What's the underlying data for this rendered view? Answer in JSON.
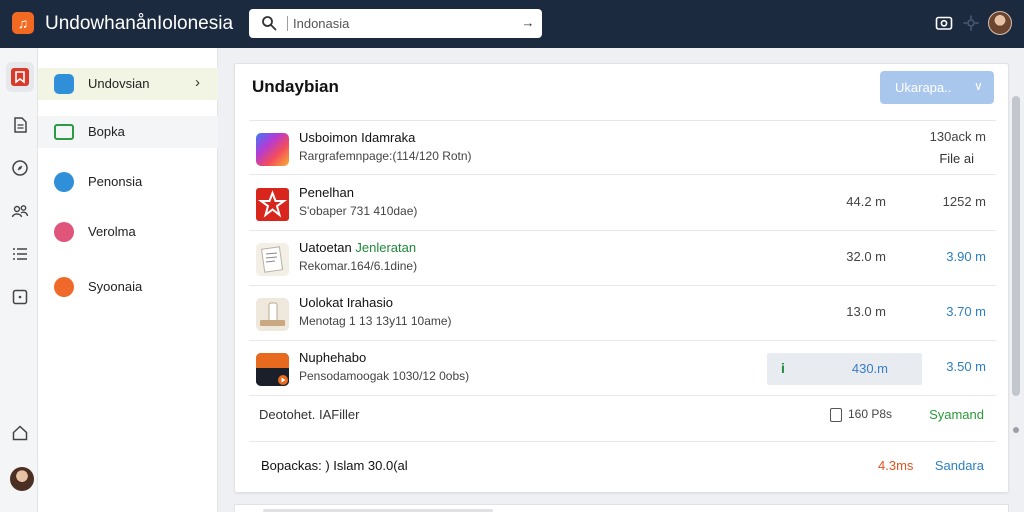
{
  "header": {
    "app_title": "UndowhanånIolonesia",
    "search_placeholder": "Indonasia",
    "search_go": "→"
  },
  "sidebar": {
    "items": [
      {
        "label": "Undovsian",
        "color": "#2f8fd8",
        "active": true,
        "chevron": "›"
      },
      {
        "label": "Bopka",
        "color": "#2c9a45"
      },
      {
        "label": "Penonsia",
        "color": "#2f8fd8"
      },
      {
        "label": "Verolma",
        "color": "#e0567a"
      },
      {
        "label": "Syoonaia",
        "color": "#ef6a2a"
      }
    ]
  },
  "main": {
    "title": "Undaybian",
    "upgrade_label": "Ukarapa..",
    "upgrade_chevron": "∨",
    "rows": [
      {
        "title": "Usboimon Idamraka",
        "subtitle": "Rargrafemnpage:(114/120 Rotn)",
        "size": "",
        "right": "130ack m",
        "right2": "File ai",
        "thumb": "gradient"
      },
      {
        "title": "Penelhan",
        "subtitle": "S'obaper 731 410dae)",
        "size": "44.2 m",
        "right": "1252 m",
        "thumb": "star"
      },
      {
        "title_prefix": "Uatoetan ",
        "title_green": "Jenleratan",
        "subtitle": "Rekomar.164/6.1dine)",
        "size": "32.0 m",
        "right": "3.90 m",
        "right_blue": true,
        "thumb": "paper"
      },
      {
        "title": "Uolokat Irahasio",
        "subtitle": "Menotag 1 13 13y11 10ame)",
        "size": "13.0 m",
        "right": "3.70 m",
        "right_blue": true,
        "thumb": "tube"
      },
      {
        "title": "Nuphehabo",
        "subtitle": "Pensodamoogak 1030/12 0obs)",
        "size": "430.m",
        "size_mark": "i",
        "right": "3.50 m",
        "right_blue": true,
        "thumb": "dark"
      }
    ],
    "footer1": {
      "label": "Deotohet. IAFiller",
      "mid": "160 P8s",
      "right": "Syamand"
    },
    "footer2": {
      "label": "Bopackas: ) Islam 30.0(al",
      "mid": "4.3ms",
      "right": "Sandara"
    }
  }
}
